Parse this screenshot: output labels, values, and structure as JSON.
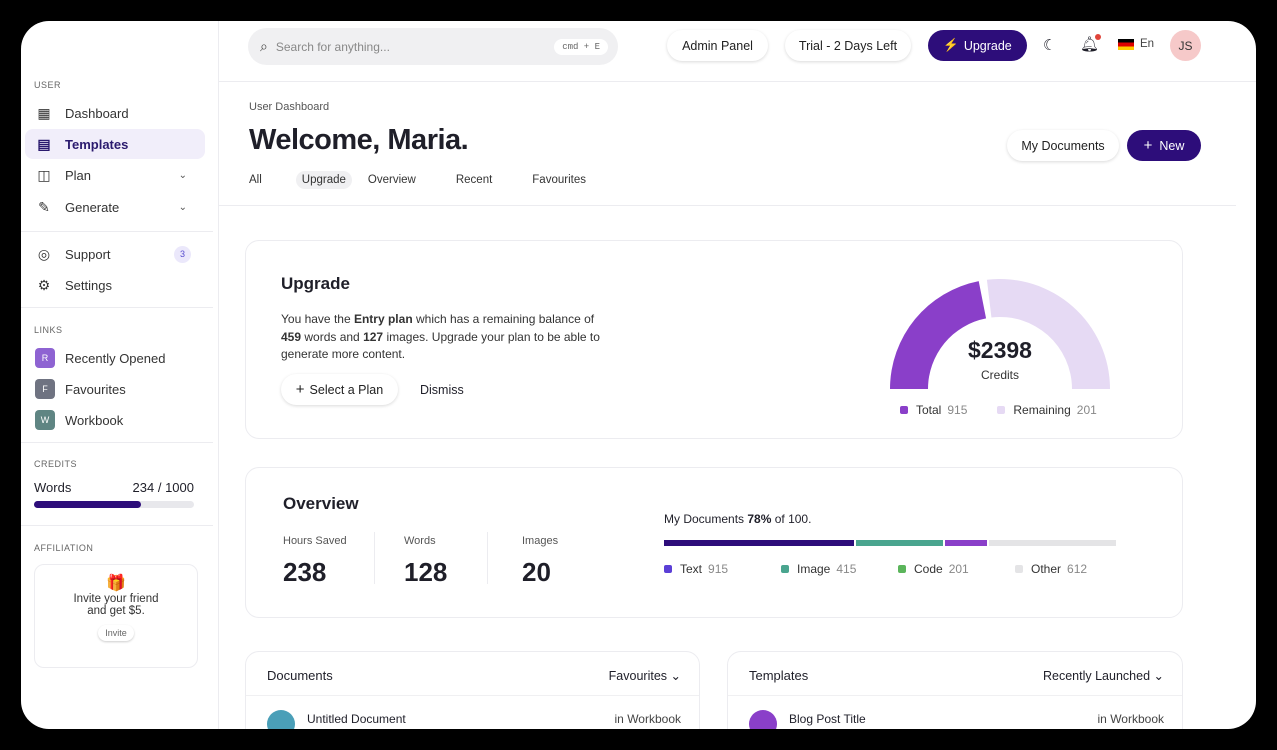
{
  "sidebar": {
    "user_label": "USER",
    "items": [
      {
        "label": "Dashboard",
        "icon": "grid-icon"
      },
      {
        "label": "Templates",
        "icon": "document-icon"
      },
      {
        "label": "Plan",
        "icon": "wallet-icon"
      },
      {
        "label": "Generate",
        "icon": "pen-icon"
      },
      {
        "label": "Support",
        "icon": "lifebuoy-icon",
        "badge": "3"
      },
      {
        "label": "Settings",
        "icon": "gear-icon"
      }
    ],
    "links_label": "LINKS",
    "links": [
      {
        "initial": "R",
        "label": "Recently Opened",
        "color": "#8e63d2"
      },
      {
        "initial": "F",
        "label": "Favourites",
        "color": "#6f7381"
      },
      {
        "initial": "W",
        "label": "Workbook",
        "color": "#5f8583"
      }
    ],
    "credits_label": "CREDITS",
    "credits": {
      "label": "Words",
      "value": "234 / 1000",
      "fraction": 0.67
    },
    "affiliation_label": "AFFILIATION",
    "affiliation": {
      "text1": "Invite your friend",
      "text2": "and get $5.",
      "button": "Invite"
    }
  },
  "header": {
    "search_placeholder": "Search for anything...",
    "shortcut": "cmd + E",
    "admin": "Admin Panel",
    "trial": "Trial - 2 Days Left",
    "upgrade": "Upgrade",
    "lang": "En",
    "avatar": "JS"
  },
  "page": {
    "breadcrumb": "User Dashboard",
    "title": "Welcome, Maria.",
    "tabs": [
      "All",
      "Upgrade",
      "Overview",
      "Recent",
      "Favourites"
    ],
    "active_tab": "Upgrade",
    "my_documents": "My Documents",
    "new": "New"
  },
  "upgrade": {
    "title": "Upgrade",
    "t1": "You have the ",
    "plan": "Entry plan",
    "t2": " which has a remaining balance of",
    "words": "459",
    "t3": " words and ",
    "images": "127",
    "t4": " images. Upgrade your plan to be able to",
    "t5": "generate more content.",
    "select": "Select a Plan",
    "dismiss": "Dismiss",
    "gauge": {
      "amount": "$2398",
      "label": "Credits",
      "fill_fraction": 0.45,
      "total_label": "Total",
      "total": "915",
      "remaining_label": "Remaining",
      "remaining": "201",
      "colors": [
        "#8a3fc9",
        "#e6daf4"
      ]
    }
  },
  "overview": {
    "title": "Overview",
    "stats": [
      {
        "label": "Hours Saved",
        "value": "238"
      },
      {
        "label": "Words",
        "value": "128"
      },
      {
        "label": "Images",
        "value": "20"
      }
    ],
    "docs_pre": "My Documents ",
    "docs_pct": "78%",
    "docs_post": " of 100.",
    "segments": [
      {
        "label": "Text",
        "value": 915,
        "color": "#2d0d7a",
        "dot": "#5b3fd6"
      },
      {
        "label": "Image",
        "value": 415,
        "color": "#4aa58f",
        "dot": "#4aa58f"
      },
      {
        "label": "Code",
        "value": 201,
        "color": "#8a3fc9",
        "dot": "#5bb55b"
      },
      {
        "label": "Other",
        "value": 612,
        "color": "#e4e4e6",
        "dot": "#e4e4e6"
      }
    ]
  },
  "documents": {
    "title": "Documents",
    "filter": "Favourites",
    "row": {
      "name": "Untitled Document",
      "where": "in Workbook"
    }
  },
  "templates": {
    "title": "Templates",
    "filter": "Recently Launched",
    "row": {
      "name": "Blog Post Title",
      "where": "in Workbook"
    }
  }
}
